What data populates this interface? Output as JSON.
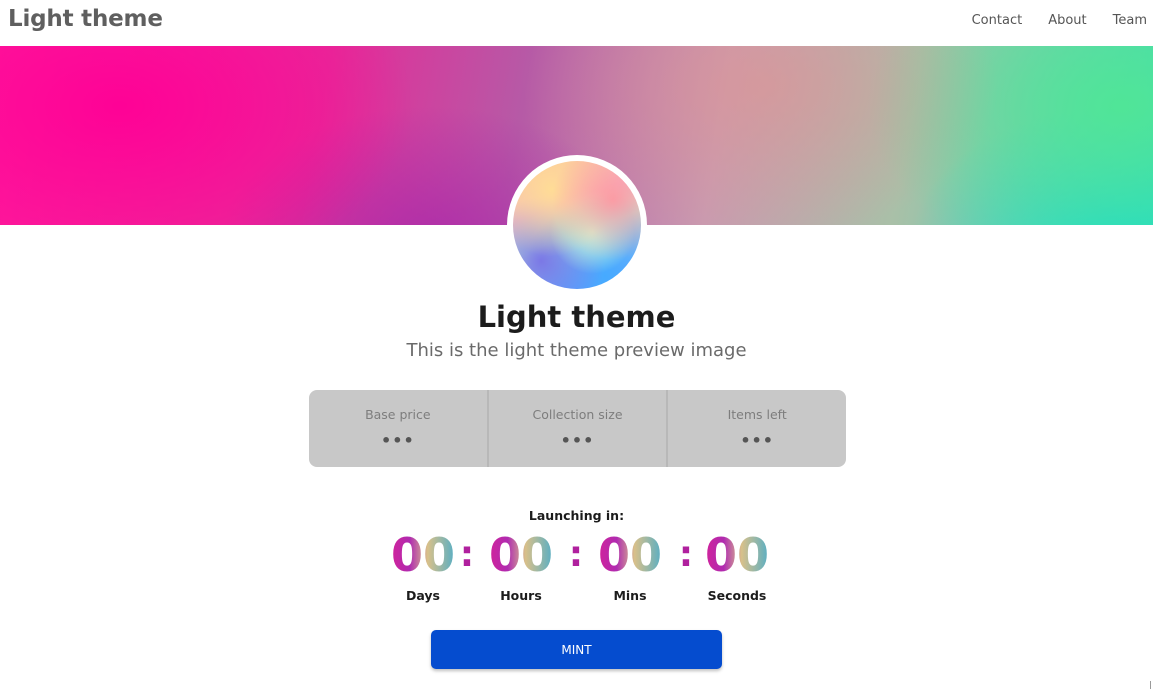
{
  "navbar": {
    "brand": "Light theme",
    "links": [
      "Contact",
      "About",
      "Team"
    ]
  },
  "hero": {
    "title": "Light theme",
    "subtitle": "This is the light theme preview image"
  },
  "stats": [
    {
      "label": "Base price",
      "value": "•••"
    },
    {
      "label": "Collection size",
      "value": "•••"
    },
    {
      "label": "Items left",
      "value": "•••"
    }
  ],
  "countdown": {
    "label": "Launching in:",
    "separator": ":",
    "units": [
      {
        "value": "00",
        "label": "Days"
      },
      {
        "value": "00",
        "label": "Hours"
      },
      {
        "value": "00",
        "label": "Mins"
      },
      {
        "value": "00",
        "label": "Seconds"
      }
    ]
  },
  "mint_button": {
    "label": "MINT"
  },
  "colors": {
    "mint_button": "#054ccf",
    "stats_panel": "#c8c8c8",
    "digit_gradient": [
      "#e91e8c",
      "#b02ab0",
      "#d8c08a",
      "#1aa6e0"
    ],
    "separator": "#b0209e"
  }
}
